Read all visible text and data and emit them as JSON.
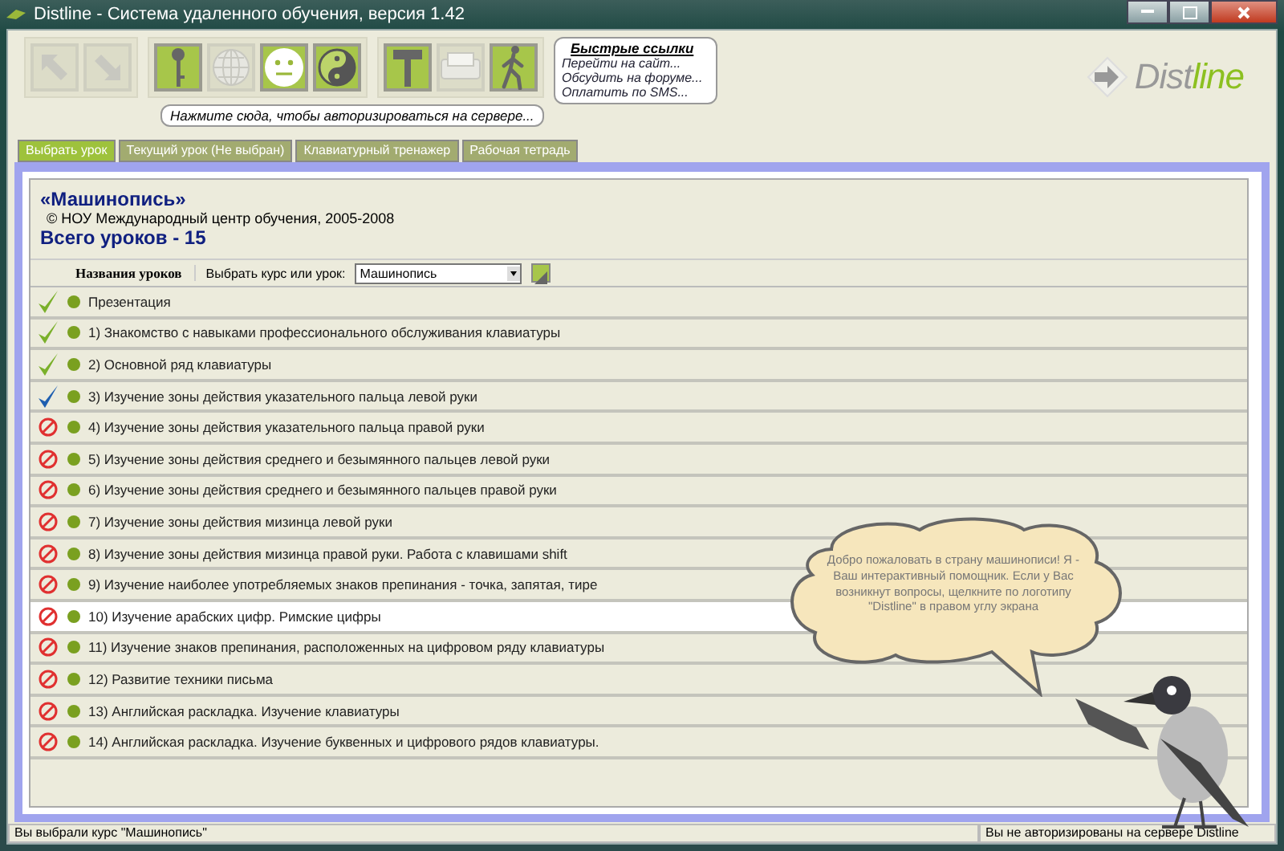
{
  "window": {
    "title": "Distline - Система удаленного обучения, версия 1.42"
  },
  "toolbar": {
    "groups": [
      [
        {
          "kind": "back",
          "disabled": true
        },
        {
          "kind": "forward",
          "disabled": true
        }
      ],
      [
        {
          "kind": "key",
          "disabled": false
        },
        {
          "kind": "globe",
          "disabled": true
        },
        {
          "kind": "smiley",
          "disabled": false
        },
        {
          "kind": "yinyang",
          "disabled": false
        }
      ],
      [
        {
          "kind": "hammer",
          "disabled": false
        },
        {
          "kind": "printer",
          "disabled": true
        },
        {
          "kind": "walker",
          "disabled": false
        }
      ]
    ],
    "hint": "Нажмите сюда, чтобы авторизироваться на сервере..."
  },
  "quick_links": {
    "title": "Быстрые ссылки",
    "links": [
      "Перейти на сайт...",
      "Обсудить на форуме...",
      "Оплатить по SMS..."
    ]
  },
  "logo": {
    "lead": "Dist",
    "accent": "line"
  },
  "tabs": [
    {
      "label": "Выбрать урок",
      "selected": true
    },
    {
      "label": "Текущий урок (Не выбран)",
      "selected": false
    },
    {
      "label": "Клавиатурный тренажер",
      "selected": false
    },
    {
      "label": "Рабочая тетрадь",
      "selected": false
    }
  ],
  "course": {
    "title": "«Машинопись»",
    "copyright": "© НОУ Международный центр обучения, 2005-2008",
    "total": "Всего уроков - 15"
  },
  "list_header": {
    "column": "Названия уроков",
    "picker_label": "Выбрать курс или урок:",
    "picker_value": "Машинопись"
  },
  "lessons": [
    {
      "title": "Презентация",
      "kind": "done",
      "selected": false
    },
    {
      "title": "1) Знакомство с навыками профессионального обслуживания клавиатуры",
      "kind": "done",
      "selected": false
    },
    {
      "title": "2) Основной ряд клавиатуры",
      "kind": "done",
      "selected": false
    },
    {
      "title": "3) Изучение зоны действия указательного пальца левой руки",
      "kind": "current",
      "selected": false
    },
    {
      "title": "4) Изучение зоны действия указательного пальца правой руки",
      "kind": "locked",
      "selected": false
    },
    {
      "title": "5) Изучение зоны действия среднего и безымянного пальцев левой руки",
      "kind": "locked",
      "selected": false
    },
    {
      "title": "6) Изучение зоны действия среднего и безымянного пальцев правой руки",
      "kind": "locked",
      "selected": false
    },
    {
      "title": "7) Изучение зоны действия мизинца левой руки",
      "kind": "locked",
      "selected": false
    },
    {
      "title": "8) Изучение зоны действия мизинца правой руки. Работа с клавишами shift",
      "kind": "locked",
      "selected": false
    },
    {
      "title": "9) Изучение наиболее употребляемых знаков препинания - точка, запятая, тире",
      "kind": "locked",
      "selected": false
    },
    {
      "title": "10) Изучение арабских цифр. Римские цифры",
      "kind": "locked",
      "selected": true
    },
    {
      "title": "11) Изучение знаков препинания, расположенных на цифровом ряду клавиатуры",
      "kind": "locked",
      "selected": false
    },
    {
      "title": "12) Развитие техники письма",
      "kind": "locked",
      "selected": false
    },
    {
      "title": "13) Английская раскладка. Изучение клавиатуры",
      "kind": "locked",
      "selected": false
    },
    {
      "title": "14) Английская раскладка. Изучение буквенных и цифрового рядов клавиатуры.",
      "kind": "locked",
      "selected": false
    }
  ],
  "assistant": {
    "message": "Добро пожаловать в страну машинописи! Я - Ваш интерактивный помощник. Если у Вас возникнут вопросы, щелкните по логотипу \"Distline\" в правом углу экрана"
  },
  "status_bar": {
    "left": "Вы выбрали курс \"Машинопись\"",
    "right": "Вы не авторизированы на сервере Distline"
  }
}
